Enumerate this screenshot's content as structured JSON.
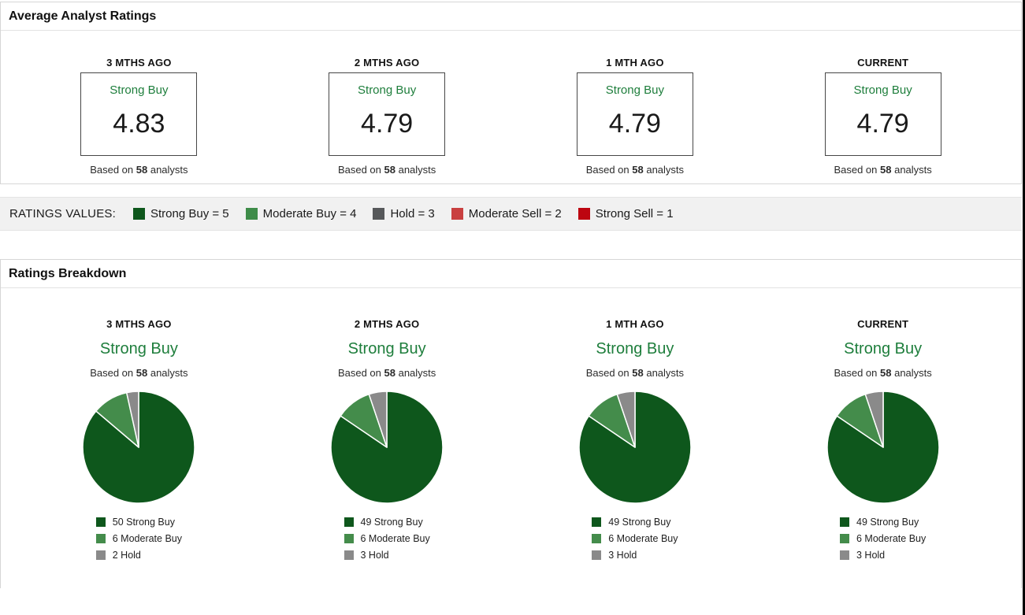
{
  "panel1": {
    "title": "Average Analyst Ratings",
    "cards": [
      {
        "period": "3 MTHS AGO",
        "rating": "Strong Buy",
        "value": "4.83",
        "based_prefix": "Based on",
        "analyst_count": "58",
        "based_suffix": "analysts"
      },
      {
        "period": "2 MTHS AGO",
        "rating": "Strong Buy",
        "value": "4.79",
        "based_prefix": "Based on",
        "analyst_count": "58",
        "based_suffix": "analysts"
      },
      {
        "period": "1 MTH AGO",
        "rating": "Strong Buy",
        "value": "4.79",
        "based_prefix": "Based on",
        "analyst_count": "58",
        "based_suffix": "analysts"
      },
      {
        "period": "CURRENT",
        "rating": "Strong Buy",
        "value": "4.79",
        "based_prefix": "Based on",
        "analyst_count": "58",
        "based_suffix": "analysts"
      }
    ]
  },
  "ratings_values": {
    "label": "RATINGS VALUES:",
    "items": [
      {
        "label": "Strong Buy = 5",
        "color": "#0e571c"
      },
      {
        "label": "Moderate Buy = 4",
        "color": "#3e8c49"
      },
      {
        "label": "Hold = 3",
        "color": "#56585a"
      },
      {
        "label": "Moderate Sell = 2",
        "color": "#c94040"
      },
      {
        "label": "Strong Sell = 1",
        "color": "#bd0510"
      }
    ]
  },
  "panel2": {
    "title": "Ratings Breakdown",
    "charts": [
      {
        "period": "3 MTHS AGO",
        "rating": "Strong Buy",
        "based_prefix": "Based on",
        "analyst_count": "58",
        "based_suffix": "analysts",
        "legend": [
          {
            "label": "50 Strong Buy"
          },
          {
            "label": "6 Moderate Buy"
          },
          {
            "label": "2 Hold"
          }
        ]
      },
      {
        "period": "2 MTHS AGO",
        "rating": "Strong Buy",
        "based_prefix": "Based on",
        "analyst_count": "58",
        "based_suffix": "analysts",
        "legend": [
          {
            "label": "49 Strong Buy"
          },
          {
            "label": "6 Moderate Buy"
          },
          {
            "label": "3 Hold"
          }
        ]
      },
      {
        "period": "1 MTH AGO",
        "rating": "Strong Buy",
        "based_prefix": "Based on",
        "analyst_count": "58",
        "based_suffix": "analysts",
        "legend": [
          {
            "label": "49 Strong Buy"
          },
          {
            "label": "6 Moderate Buy"
          },
          {
            "label": "3 Hold"
          }
        ]
      },
      {
        "period": "CURRENT",
        "rating": "Strong Buy",
        "based_prefix": "Based on",
        "analyst_count": "58",
        "based_suffix": "analysts",
        "legend": [
          {
            "label": "49 Strong Buy"
          },
          {
            "label": "6 Moderate Buy"
          },
          {
            "label": "3 Hold"
          }
        ]
      }
    ]
  },
  "chart_data": [
    {
      "type": "table",
      "title": "Average Analyst Ratings",
      "categories": [
        "3 MTHS AGO",
        "2 MTHS AGO",
        "1 MTH AGO",
        "CURRENT"
      ],
      "values": [
        4.83,
        4.79,
        4.79,
        4.79
      ],
      "rating_labels": [
        "Strong Buy",
        "Strong Buy",
        "Strong Buy",
        "Strong Buy"
      ],
      "analysts_per_period": [
        58,
        58,
        58,
        58
      ],
      "scale": {
        "Strong Buy": 5,
        "Moderate Buy": 4,
        "Hold": 3,
        "Moderate Sell": 2,
        "Strong Sell": 1
      }
    },
    {
      "type": "pie",
      "title": "3 MTHS AGO",
      "labels": [
        "Strong Buy",
        "Moderate Buy",
        "Hold"
      ],
      "values": [
        50,
        6,
        2
      ],
      "colors": [
        "#0e571c",
        "#448c4b",
        "#8a8a8a"
      ],
      "start_angle": "12-oclock",
      "direction": "clockwise",
      "total_analysts": 58
    },
    {
      "type": "pie",
      "title": "2 MTHS AGO",
      "labels": [
        "Strong Buy",
        "Moderate Buy",
        "Hold"
      ],
      "values": [
        49,
        6,
        3
      ],
      "colors": [
        "#0e571c",
        "#448c4b",
        "#8a8a8a"
      ],
      "start_angle": "12-oclock",
      "direction": "clockwise",
      "total_analysts": 58
    },
    {
      "type": "pie",
      "title": "1 MTH AGO",
      "labels": [
        "Strong Buy",
        "Moderate Buy",
        "Hold"
      ],
      "values": [
        49,
        6,
        3
      ],
      "colors": [
        "#0e571c",
        "#448c4b",
        "#8a8a8a"
      ],
      "start_angle": "12-oclock",
      "direction": "clockwise",
      "total_analysts": 58
    },
    {
      "type": "pie",
      "title": "CURRENT",
      "labels": [
        "Strong Buy",
        "Moderate Buy",
        "Hold"
      ],
      "values": [
        49,
        6,
        3
      ],
      "colors": [
        "#0e571c",
        "#448c4b",
        "#8a8a8a"
      ],
      "start_angle": "12-oclock",
      "direction": "clockwise",
      "total_analysts": 58
    }
  ]
}
